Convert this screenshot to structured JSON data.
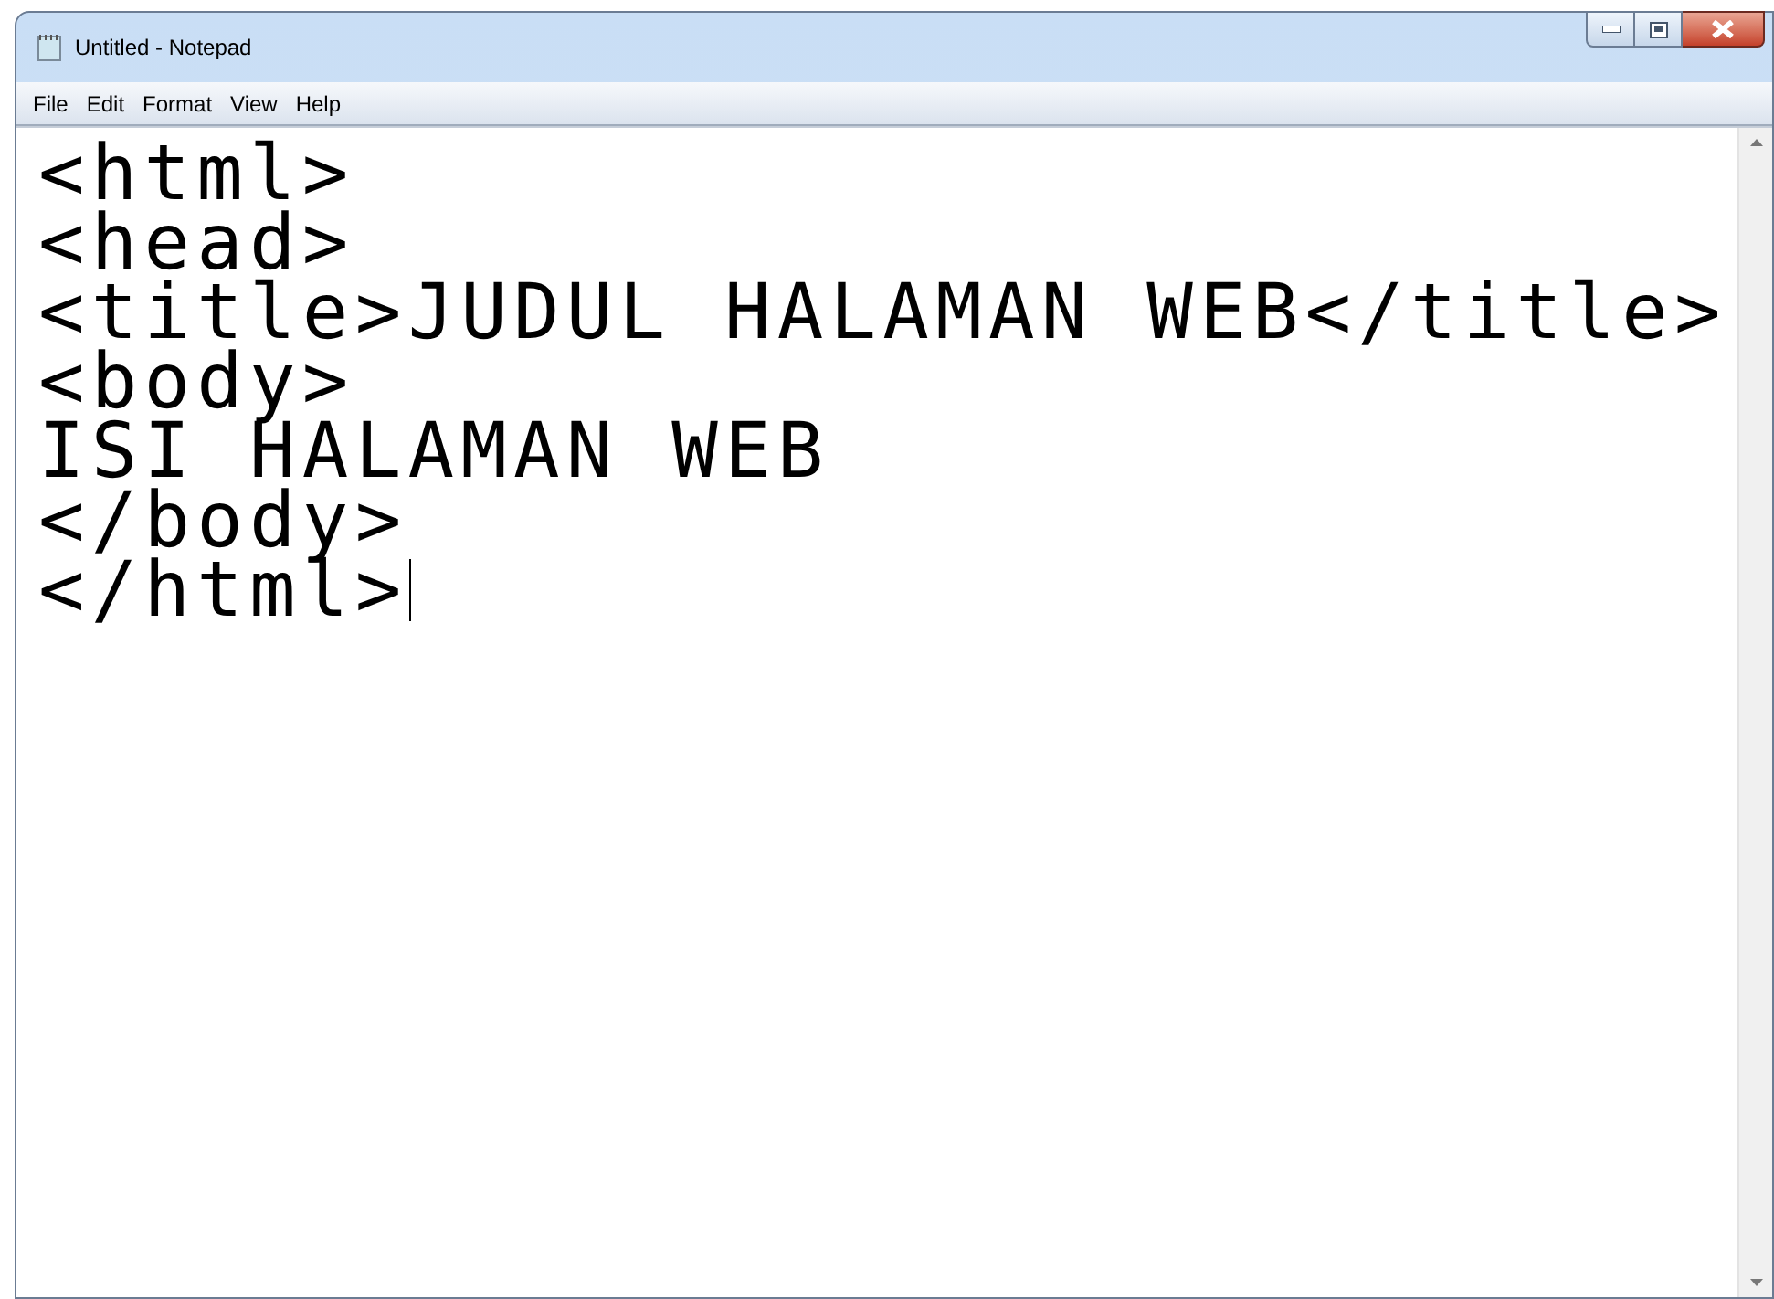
{
  "window": {
    "title": "Untitled - Notepad"
  },
  "menu": [
    "File",
    "Edit",
    "Format",
    "View",
    "Help"
  ],
  "editor": {
    "lines": [
      "<html>",
      "<head>",
      "<title>JUDUL HALAMAN WEB</title>",
      "<body>",
      "ISI HALAMAN WEB",
      "</body>",
      "</html>"
    ]
  }
}
